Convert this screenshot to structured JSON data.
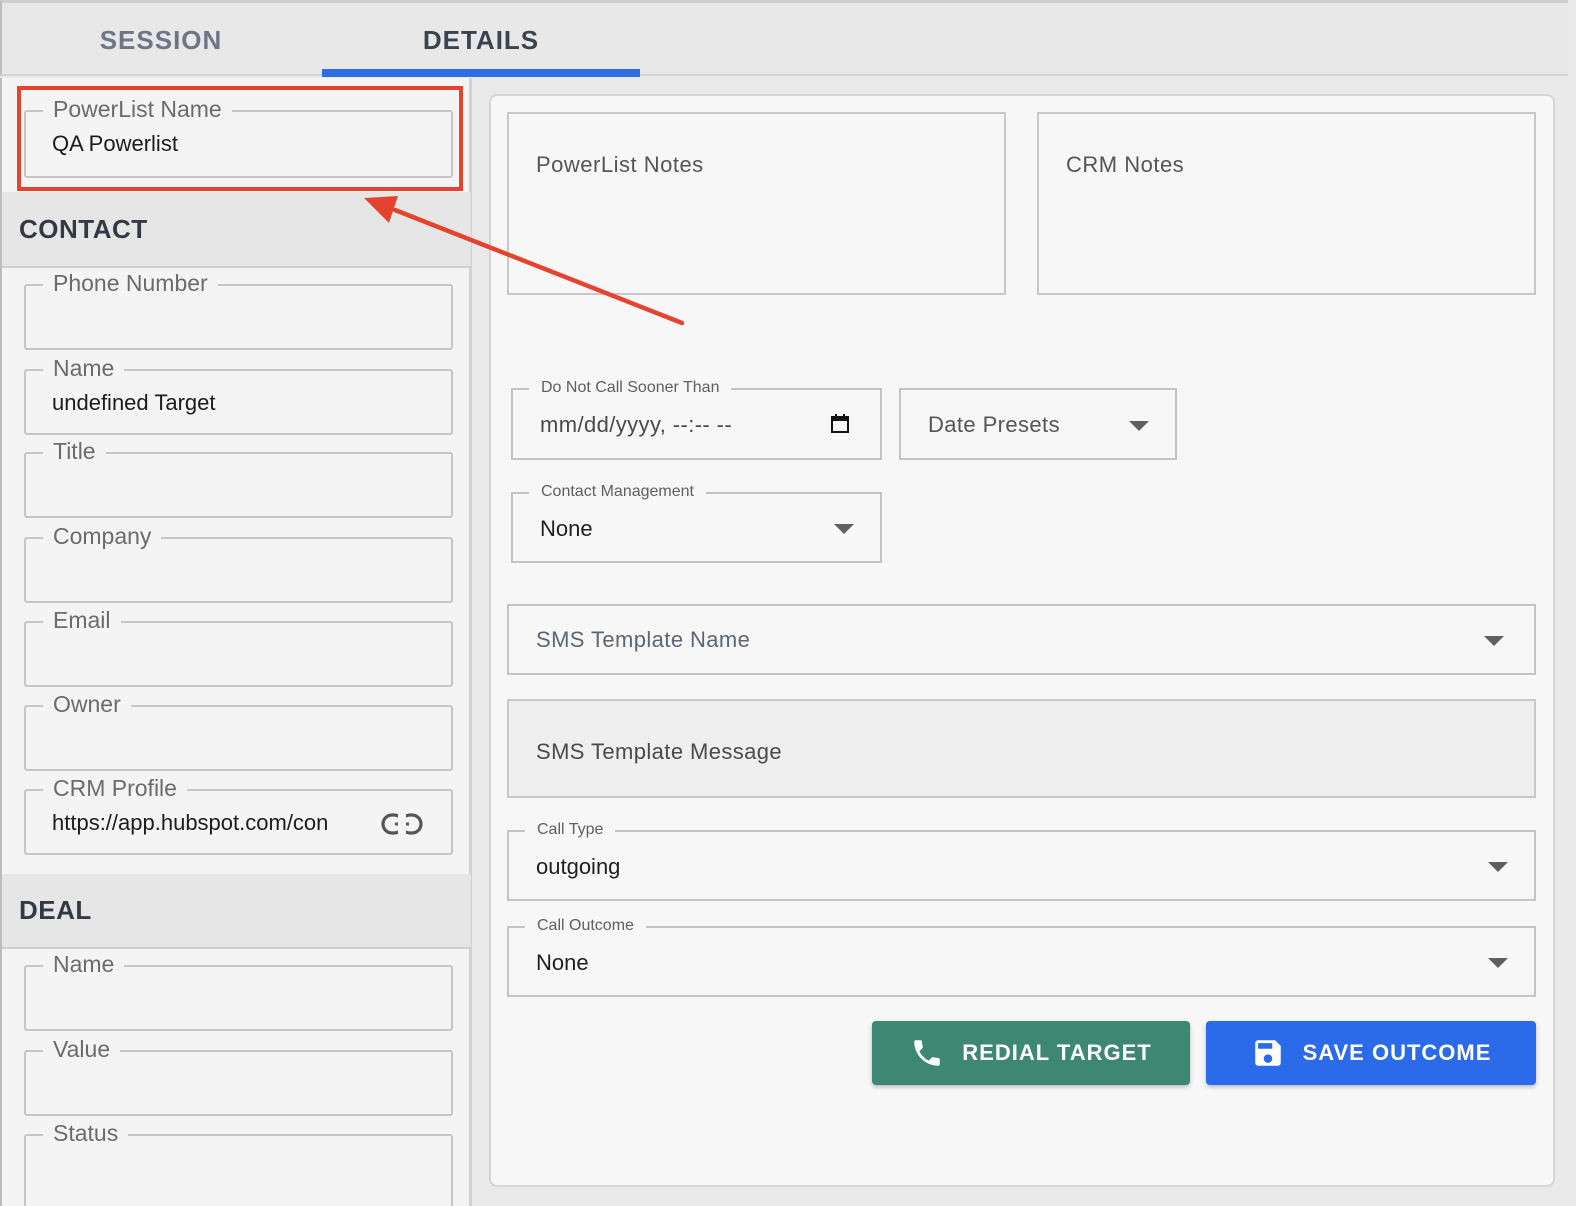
{
  "tabs": [
    {
      "label": "SESSION"
    },
    {
      "label": "DETAILS"
    }
  ],
  "left": {
    "powerlist_name": {
      "label": "PowerList Name",
      "value": "QA Powerlist"
    },
    "contact": {
      "title": "CONTACT",
      "phone": {
        "label": "Phone Number",
        "value": ""
      },
      "name": {
        "label": "Name",
        "value": "undefined Target"
      },
      "title_field": {
        "label": "Title",
        "value": ""
      },
      "company": {
        "label": "Company",
        "value": ""
      },
      "email": {
        "label": "Email",
        "value": ""
      },
      "owner": {
        "label": "Owner",
        "value": ""
      },
      "crm_profile": {
        "label": "CRM Profile",
        "value": "https://app.hubspot.com/con",
        "icon": "link-icon"
      }
    },
    "deal": {
      "title": "DEAL",
      "name": {
        "label": "Name",
        "value": ""
      },
      "value": {
        "label": "Value",
        "value": ""
      },
      "status": {
        "label": "Status",
        "value": ""
      }
    }
  },
  "right": {
    "powerlist_notes": {
      "placeholder": "PowerList Notes"
    },
    "crm_notes": {
      "placeholder": "CRM Notes"
    },
    "do_not_call": {
      "label": "Do Not Call Sooner Than",
      "placeholder": "mm/dd/yyyy, --:-- --",
      "icon": "calendar-icon"
    },
    "date_presets": {
      "placeholder": "Date Presets"
    },
    "contact_management": {
      "label": "Contact Management",
      "value": "None"
    },
    "sms_template_name": {
      "placeholder": "SMS Template Name"
    },
    "sms_template_message": {
      "placeholder": "SMS Template Message"
    },
    "call_type": {
      "label": "Call Type",
      "value": "outgoing"
    },
    "call_outcome": {
      "label": "Call Outcome",
      "value": "None"
    },
    "buttons": {
      "redial": {
        "label": "REDIAL TARGET",
        "icon": "phone-icon"
      },
      "save": {
        "label": "SAVE OUTCOME",
        "icon": "floppy-disk-icon"
      }
    }
  },
  "colors": {
    "tab_indicator": "#2f6de3",
    "highlight": "#e4442e",
    "redial_button": "#3d8773",
    "save_button": "#2b6ae9"
  }
}
